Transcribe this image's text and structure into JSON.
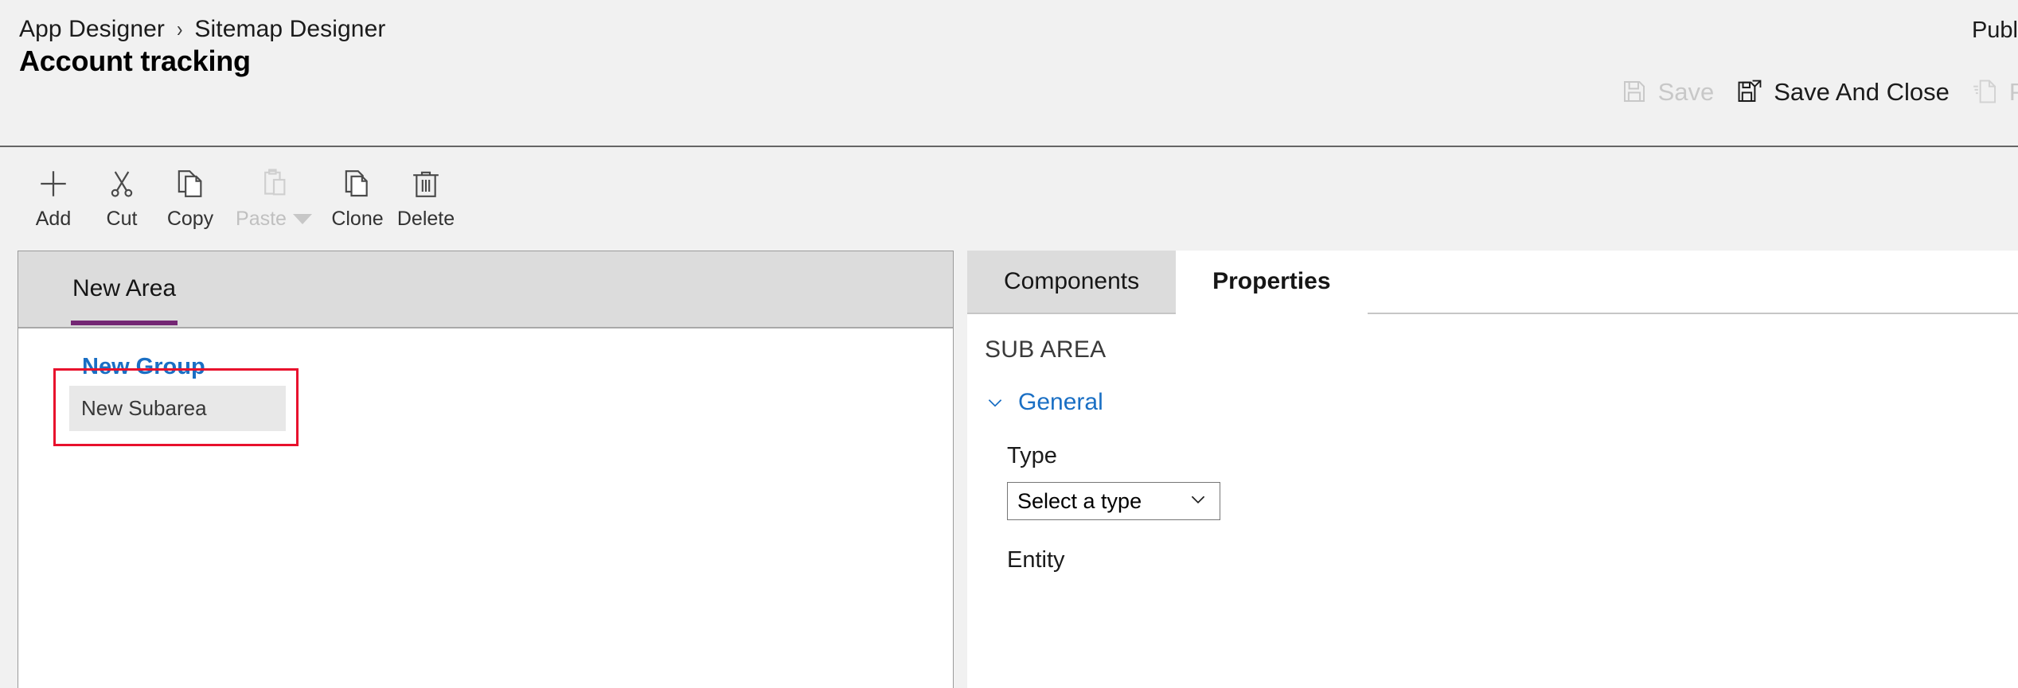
{
  "header": {
    "breadcrumb": [
      {
        "label": "App Designer"
      },
      {
        "label": "Sitemap Designer"
      }
    ],
    "breadcrumb_separator": "›",
    "title": "Account tracking",
    "status_text": "Publ",
    "commands": [
      {
        "id": "save",
        "label": "Save",
        "icon": "save-icon",
        "enabled": false
      },
      {
        "id": "save-and-close",
        "label": "Save And Close",
        "icon": "save-and-close-icon",
        "enabled": true
      },
      {
        "id": "publish",
        "label": "Pub",
        "icon": "publish-icon",
        "enabled": false
      }
    ]
  },
  "toolbar": {
    "buttons": [
      {
        "id": "add",
        "label": "Add",
        "icon": "plus-icon",
        "enabled": true,
        "has_caret": false
      },
      {
        "id": "cut",
        "label": "Cut",
        "icon": "scissors-icon",
        "enabled": true,
        "has_caret": false
      },
      {
        "id": "copy",
        "label": "Copy",
        "icon": "copy-icon",
        "enabled": true,
        "has_caret": false
      },
      {
        "id": "paste",
        "label": "Paste",
        "icon": "clipboard-icon",
        "enabled": false,
        "has_caret": true
      },
      {
        "id": "clone",
        "label": "Clone",
        "icon": "clone-icon",
        "enabled": true,
        "has_caret": false
      },
      {
        "id": "delete",
        "label": "Delete",
        "icon": "trash-icon",
        "enabled": true,
        "has_caret": false
      }
    ]
  },
  "canvas": {
    "area_tab": "New Area",
    "group_label": "New Group",
    "subarea_label": "New Subarea",
    "selection_color": "#e8112d",
    "tab_indicator_color": "#742774",
    "link_color": "#1a6fc4"
  },
  "panel": {
    "tabs": [
      {
        "id": "components",
        "label": "Components",
        "active": false
      },
      {
        "id": "properties",
        "label": "Properties",
        "active": true
      }
    ],
    "heading": "SUB AREA",
    "section": {
      "label": "General",
      "expanded": true
    },
    "fields": [
      {
        "id": "type",
        "label": "Type",
        "control": "select",
        "value": "Select a type"
      },
      {
        "id": "entity",
        "label": "Entity",
        "control": "none",
        "value": ""
      }
    ]
  }
}
